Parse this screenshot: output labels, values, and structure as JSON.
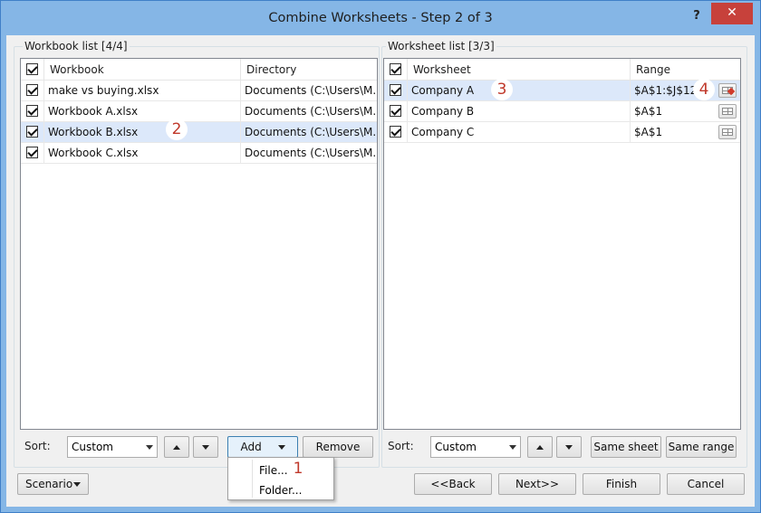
{
  "window": {
    "title": "Combine Worksheets - Step 2 of 3",
    "help": "?",
    "close": "✕"
  },
  "workbook_list": {
    "title": "Workbook list [4/4]",
    "columns": [
      "Workbook",
      "Directory"
    ],
    "rows": [
      {
        "name": "make vs buying.xlsx",
        "dir": "Documents (C:\\Users\\M...",
        "checked": true,
        "selected": false
      },
      {
        "name": "Workbook A.xlsx",
        "dir": "Documents (C:\\Users\\M...",
        "checked": true,
        "selected": false
      },
      {
        "name": "Workbook B.xlsx",
        "dir": "Documents (C:\\Users\\M...",
        "checked": true,
        "selected": true
      },
      {
        "name": "Workbook C.xlsx",
        "dir": "Documents (C:\\Users\\M...",
        "checked": true,
        "selected": false
      }
    ],
    "sort_label": "Sort:",
    "sort_value": "Custom",
    "add_label": "Add",
    "remove_label": "Remove"
  },
  "worksheet_list": {
    "title": "Worksheet list [3/3]",
    "columns": [
      "Worksheet",
      "Range"
    ],
    "rows": [
      {
        "name": "Company A",
        "range": "$A$1:$J$12",
        "checked": true,
        "selected": true
      },
      {
        "name": "Company B",
        "range": "$A$1",
        "checked": true,
        "selected": false
      },
      {
        "name": "Company C",
        "range": "$A$1",
        "checked": true,
        "selected": false
      }
    ],
    "sort_label": "Sort:",
    "sort_value": "Custom",
    "same_sheet_label": "Same sheet",
    "same_range_label": "Same range"
  },
  "add_menu": {
    "items": [
      "File...",
      "Folder..."
    ]
  },
  "footer": {
    "scenario_label": "Scenario",
    "back_label": "<<Back",
    "next_label": "Next>>",
    "finish_label": "Finish",
    "cancel_label": "Cancel"
  },
  "badges": [
    "1",
    "2",
    "3",
    "4"
  ],
  "colors": {
    "title_bar": "#85b6e6",
    "close_button": "#c7413b",
    "selection": "#dce8fa",
    "badge_text": "#c0392b"
  }
}
